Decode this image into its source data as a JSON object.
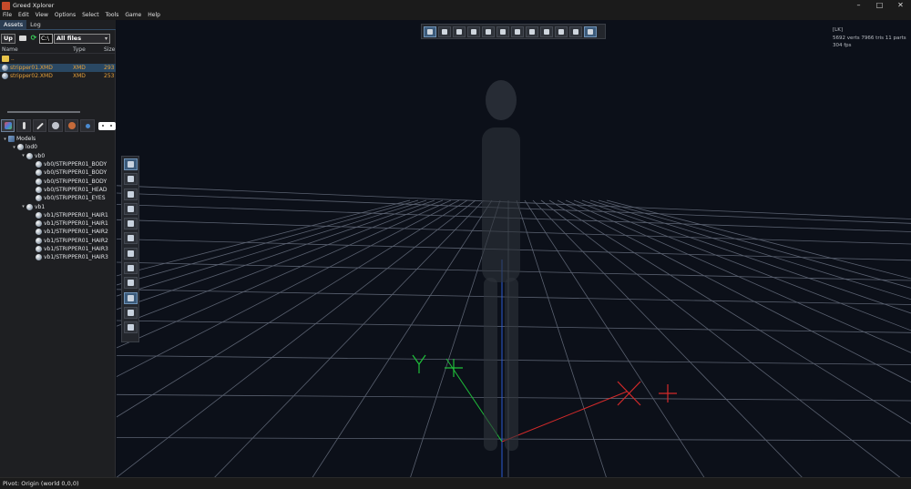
{
  "window": {
    "title": "Greed Xplorer",
    "controls": [
      "–",
      "□",
      "✕"
    ]
  },
  "menu": [
    "File",
    "Edit",
    "View",
    "Options",
    "Select",
    "Tools",
    "Game",
    "Help"
  ],
  "tabs": [
    {
      "label": "Assets",
      "active": true
    },
    {
      "label": "Log",
      "active": false
    }
  ],
  "asset_toolbar": {
    "up_label": "Up",
    "drive_value": "C:\\",
    "filter_value": "All files",
    "refresh_icon": "refresh-icon",
    "folder_icon": "folder-open-icon"
  },
  "file_columns": [
    "Name",
    "Type",
    "Size"
  ],
  "files": [
    {
      "name": "..",
      "type": "",
      "size": "",
      "icon": "folder-icon",
      "selected": false
    },
    {
      "name": "stripper01.XMD",
      "type": "XMD",
      "size": "293",
      "icon": "mesh-icon",
      "selected": true
    },
    {
      "name": "stripper02.XMD",
      "type": "XMD",
      "size": "253",
      "icon": "mesh-icon",
      "selected": false
    }
  ],
  "tree": [
    {
      "label": "Models",
      "level": 0,
      "arrow": "▾",
      "kind": "model"
    },
    {
      "label": "lod0",
      "level": 1,
      "arrow": "▾",
      "kind": "node"
    },
    {
      "label": "vb0",
      "level": 2,
      "arrow": "▾",
      "kind": "node"
    },
    {
      "label": "vb0/STRIPPER01_BODY",
      "level": 3,
      "arrow": "",
      "kind": "node"
    },
    {
      "label": "vb0/STRIPPER01_BODY",
      "level": 3,
      "arrow": "",
      "kind": "node"
    },
    {
      "label": "vb0/STRIPPER01_BODY",
      "level": 3,
      "arrow": "",
      "kind": "node"
    },
    {
      "label": "vb0/STRIPPER01_HEAD",
      "level": 3,
      "arrow": "",
      "kind": "node"
    },
    {
      "label": "vb0/STRIPPER01_EYES",
      "level": 3,
      "arrow": "",
      "kind": "node"
    },
    {
      "label": "vb1",
      "level": 2,
      "arrow": "▾",
      "kind": "node"
    },
    {
      "label": "vb1/STRIPPER01_HAIR1",
      "level": 3,
      "arrow": "",
      "kind": "node"
    },
    {
      "label": "vb1/STRIPPER01_HAIR1",
      "level": 3,
      "arrow": "",
      "kind": "node"
    },
    {
      "label": "vb1/STRIPPER01_HAIR2",
      "level": 3,
      "arrow": "",
      "kind": "node"
    },
    {
      "label": "vb1/STRIPPER01_HAIR2",
      "level": 3,
      "arrow": "",
      "kind": "node"
    },
    {
      "label": "vb1/STRIPPER01_HAIR3",
      "level": 3,
      "arrow": "",
      "kind": "node"
    },
    {
      "label": "vb1/STRIPPER01_HAIR3",
      "level": 3,
      "arrow": "",
      "kind": "node"
    }
  ],
  "viewport": {
    "mode": "[LK]",
    "stats_line": "5692 verts  7966 tris  11 parts",
    "fps": "304 fps",
    "top_tools": [
      "camera-icon",
      "sphere-icon",
      "shade-icon",
      "texture-icon",
      "material-icon",
      "light-icon",
      "lighting-icon",
      "checker-icon",
      "wireframe-icon",
      "grid-icon",
      "bones-icon",
      "export-icon"
    ],
    "side_tools": [
      "screenshot-icon",
      "cube-icon",
      "skeleton-icon",
      "rotate-icon",
      "scale-icon",
      "transform-icon",
      "move-icon",
      "undo-icon",
      "redo-icon",
      "axis-icon",
      "sun-icon",
      "color-icon"
    ],
    "gizmo_colors": {
      "x": "#d42a2a",
      "y": "#1fbf3a",
      "z": "#2a5ad4"
    }
  },
  "status": "Pivot: Origin (world 0,0,0)"
}
